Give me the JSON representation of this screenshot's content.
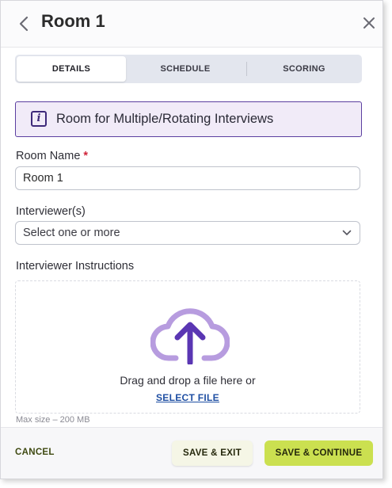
{
  "header": {
    "title": "Room 1",
    "back_icon": "chevron-left-icon",
    "close_icon": "close-icon"
  },
  "tabs": [
    {
      "label": "DETAILS",
      "active": true
    },
    {
      "label": "SCHEDULE",
      "active": false
    },
    {
      "label": "SCORING",
      "active": false
    }
  ],
  "info_banner": {
    "icon": "info-icon",
    "icon_glyph": "i",
    "text": "Room for Multiple/Rotating Interviews"
  },
  "room_name": {
    "label": "Room Name",
    "required_mark": "*",
    "value": "Room 1"
  },
  "interviewers": {
    "label": "Interviewer(s)",
    "placeholder": "Select one or more"
  },
  "instructions": {
    "label": "Interviewer Instructions",
    "drop_text": "Drag and drop a file here or",
    "select_file": "SELECT FILE",
    "max_size": "Max size – 200 MB",
    "upload_icon": "cloud-upload-icon"
  },
  "footer": {
    "cancel": "CANCEL",
    "save_exit": "SAVE & EXIT",
    "save_continue": "SAVE & CONTINUE"
  },
  "colors": {
    "accent_purple": "#5b3fa0",
    "upload_icon_light": "#b79cdf",
    "upload_icon_dark": "#5a36b3",
    "primary_button": "#cbe050",
    "link": "#1f4fa3",
    "required": "#d0243a"
  }
}
